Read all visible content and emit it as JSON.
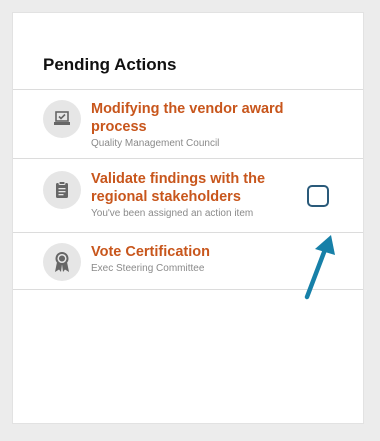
{
  "card": {
    "title": "Pending Actions"
  },
  "actions": [
    {
      "title": "Modifying the vendor award process",
      "subtitle": "Quality Management Council",
      "icon": "ballot-box-icon"
    },
    {
      "title": "Validate findings with the regional stakeholders",
      "subtitle": "You've been assigned an action item",
      "icon": "clipboard-icon",
      "checkbox_checked": false
    },
    {
      "title": "Vote Certification",
      "subtitle": "Exec Steering Committee",
      "icon": "award-ribbon-icon"
    }
  ],
  "colors": {
    "accent": "#c8561c",
    "checkbox_border": "#2a5a7a",
    "annotation_arrow": "#1780a8"
  }
}
